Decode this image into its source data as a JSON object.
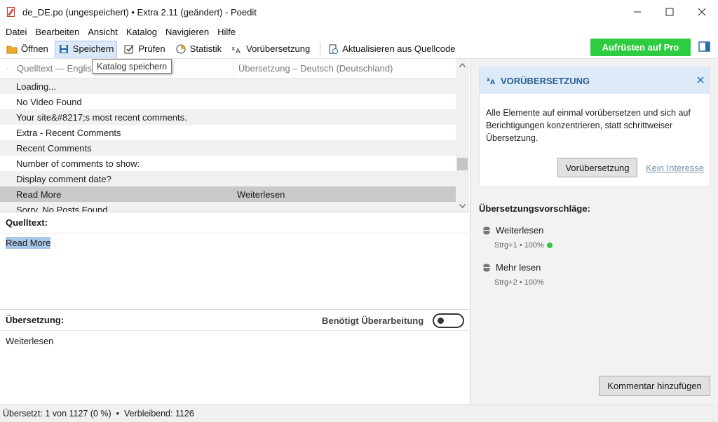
{
  "window": {
    "title": "de_DE.po (ungespeichert) • Extra 2.11 (geändert) - Poedit",
    "minimize": "—",
    "maximize": "☐",
    "close": "✕"
  },
  "menu": [
    "Datei",
    "Bearbeiten",
    "Ansicht",
    "Katalog",
    "Navigieren",
    "Hilfe"
  ],
  "toolbar": {
    "open_label": "Öffnen",
    "save_label": "Speichern",
    "validate_label": "Prüfen",
    "stats_label": "Statistik",
    "pretranslate_label": "Vorübersetzung",
    "update_label": "Aktualisieren aus Quellcode",
    "pro_label": "Aufrüsten auf Pro",
    "tooltip": "Katalog speichern"
  },
  "list": {
    "dot": "·",
    "col_source": "Quelltext — Englisch",
    "col_translation": "Übersetzung – Deutsch (Deutschland)",
    "rows": [
      {
        "source": "Loading...",
        "translation": ""
      },
      {
        "source": "No Video Found",
        "translation": ""
      },
      {
        "source": "Your site&#8217;s most recent comments.",
        "translation": ""
      },
      {
        "source": "Extra - Recent Comments",
        "translation": ""
      },
      {
        "source": "Recent Comments",
        "translation": ""
      },
      {
        "source": "Number of comments to show:",
        "translation": ""
      },
      {
        "source": "Display comment date?",
        "translation": ""
      },
      {
        "source": "Read More",
        "translation": "Weiterlesen",
        "selected": true
      },
      {
        "source": "Sorry, No Posts Found",
        "translation": ""
      }
    ]
  },
  "editor": {
    "source_label": "Quelltext:",
    "source_text": "Read More",
    "translation_label": "Übersetzung:",
    "needs_review_label": "Benötigt Überarbeitung",
    "translation_text": "Weiterlesen"
  },
  "pretranslate_card": {
    "title": "VORÜBERSETZUNG",
    "body": "Alle Elemente auf einmal vorübersetzen und sich auf Berichtigungen konzentrieren, statt schrittweiser Übersetzung.",
    "button": "Vorübersetzung",
    "link": "Kein Interesse"
  },
  "suggestions": {
    "title": "Übersetzungsvorschläge:",
    "items": [
      {
        "text": "Weiterlesen",
        "meta": "Strg+1 • 100%"
      },
      {
        "text": "Mehr lesen",
        "meta": "Strg+2 • 100%"
      }
    ],
    "comment_button": "Kommentar hinzufügen"
  },
  "status": {
    "text": "Übersetzt: 1 von 1127 (0 %)  •  Verbleibend: 1126"
  },
  "colors": {
    "accent_green": "#2ecc40",
    "card_header": "#dcebf7",
    "selection": "#a9c7e9"
  }
}
